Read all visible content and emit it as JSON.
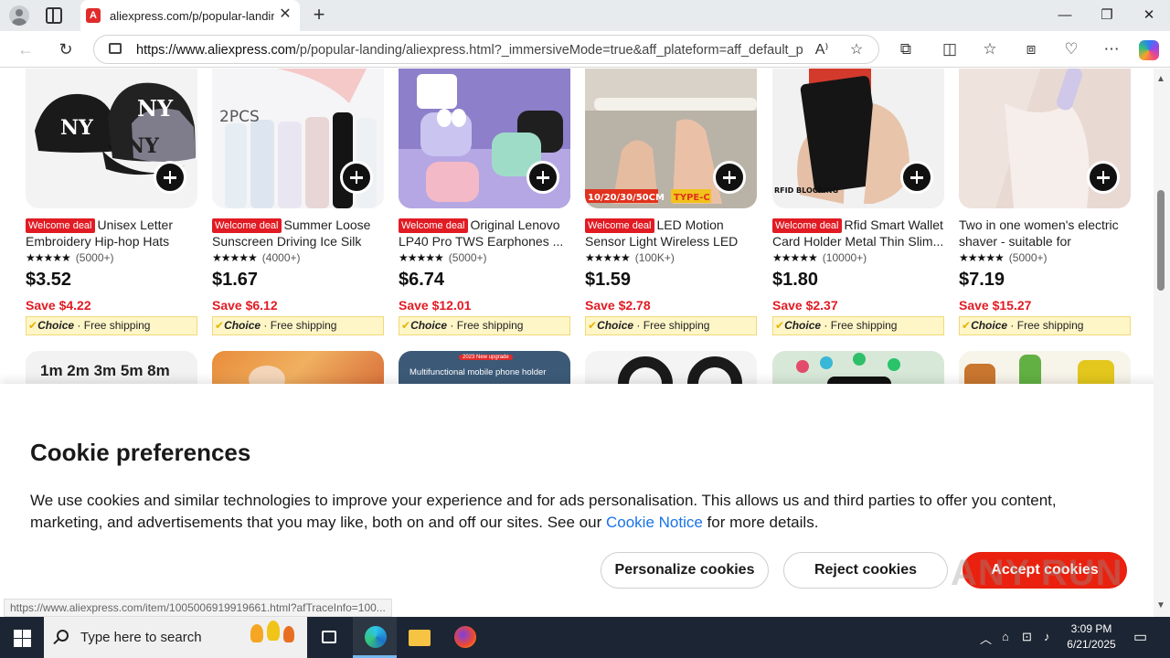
{
  "browser": {
    "tab_title": "aliexpress.com/p/popular-landing",
    "url_host": "https://www.aliexpress.com",
    "url_rest": "/p/popular-landing/aliexpress.html?_immersiveMode=true&aff_plateform=aff_default_p...",
    "status_url": "https://www.aliexpress.com/item/1005006919919661.html?afTraceInfo=100..."
  },
  "products": [
    {
      "badge": "Welcome deal",
      "title": "Unisex Letter Embroidery Hip-hop Hats Outd...",
      "stars": "★★★★★",
      "reviews": "(5000+)",
      "price": "$3.52",
      "save": "Save $4.22",
      "choice": "Choice",
      "shipping": "Free shipping",
      "image": "hats-image"
    },
    {
      "badge": "Welcome deal",
      "title": "Summer Loose Sunscreen Driving Ice Silk Sle...",
      "stars": "★★★★★",
      "reviews": "(4000+)",
      "price": "$1.67",
      "save": "Save $6.12",
      "choice": "Choice",
      "shipping": "Free shipping",
      "image": "sleeves-image",
      "image_text": "2PCS"
    },
    {
      "badge": "Welcome deal",
      "title": "Original Lenovo LP40 Pro TWS Earphones ...",
      "stars": "★★★★★",
      "reviews": "(5000+)",
      "price": "$6.74",
      "save": "Save $12.01",
      "choice": "Choice",
      "shipping": "Free shipping",
      "image": "earphones-image"
    },
    {
      "badge": "Welcome deal",
      "title": "LED Motion Sensor Light Wireless LED Nigh...",
      "stars": "★★★★★",
      "reviews": "(100K+)",
      "price": "$1.59",
      "save": "Save $2.78",
      "choice": "Choice",
      "shipping": "Free shipping",
      "image": "led-light-image",
      "image_text": "10/20/30/50CM",
      "image_text2": "TYPE-C"
    },
    {
      "badge": "Welcome deal",
      "title": "Rfid Smart Wallet Card Holder Metal Thin Slim...",
      "stars": "★★★★★",
      "reviews": "(10000+)",
      "price": "$1.80",
      "save": "Save $2.37",
      "choice": "Choice",
      "shipping": "Free shipping",
      "image": "wallet-image",
      "image_text": "RFID BLOCKING"
    },
    {
      "badge": "",
      "title": "Two in one women's electric shaver - suitable for eyebrow...",
      "stars": "★★★★★",
      "reviews": "(5000+)",
      "price": "$7.19",
      "save": "Save $15.27",
      "choice": "Choice",
      "shipping": "Free shipping",
      "image": "shaver-image"
    }
  ],
  "row2": [
    {
      "image": "tape-image",
      "text": "1m 2m 3m 5m 8m"
    },
    {
      "image": "food-image",
      "text": ""
    },
    {
      "image": "phone-holder-image",
      "text": "Multifunctional mobile phone holder",
      "tag": "2023 New upgrade"
    },
    {
      "image": "strap-image",
      "text": ""
    },
    {
      "image": "smartwatch-image",
      "text": ""
    },
    {
      "image": "toys-image",
      "text": ""
    }
  ],
  "cookie": {
    "title": "Cookie preferences",
    "text_before": "We use cookies and similar technologies to improve your experience and for ads personalisation. This allows us and third parties to offer you content, marketing, and advertisements that you may like, both on and off our sites. See our ",
    "link": "Cookie Notice",
    "text_after": " for more details.",
    "personalize": "Personalize cookies",
    "reject": "Reject cookies",
    "accept": "Accept cookies"
  },
  "taskbar": {
    "search_placeholder": "Type here to search",
    "time": "3:09 PM",
    "date": "6/21/2025"
  },
  "watermark": "ANY RUN",
  "colors": {
    "accent_red": "#e11b23",
    "accept_red": "#e9210e",
    "link_blue": "#1a73e8"
  }
}
